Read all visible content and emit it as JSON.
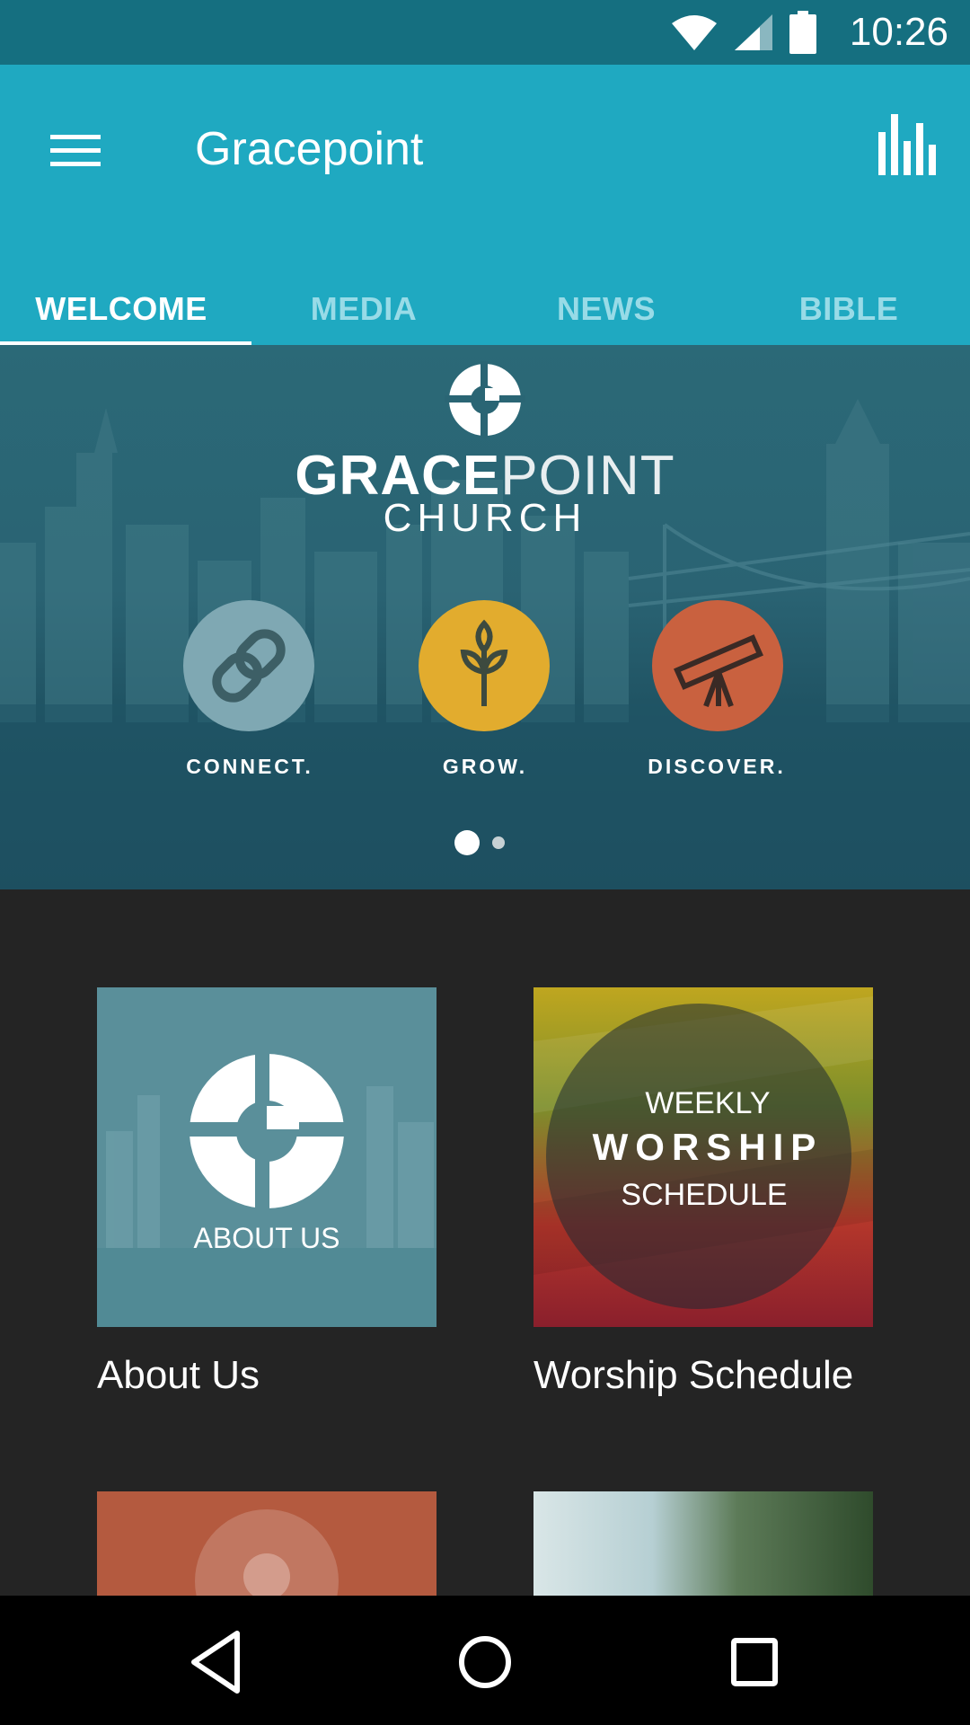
{
  "status_bar": {
    "time": "10:26",
    "icons": [
      "wifi-icon",
      "signal-icon",
      "battery-icon"
    ]
  },
  "app_bar": {
    "title": "Gracepoint",
    "menu_icon": "hamburger-menu-icon",
    "action_icon": "bar-chart-icon"
  },
  "tabs": [
    {
      "label": "WELCOME",
      "active": true
    },
    {
      "label": "MEDIA",
      "active": false
    },
    {
      "label": "NEWS",
      "active": false
    },
    {
      "label": "BIBLE",
      "active": false
    }
  ],
  "hero": {
    "brand_bold": "GRACE",
    "brand_light": "POINT",
    "brand_sub": "CHURCH",
    "pillars": [
      {
        "label": "CONNECT.",
        "icon": "chain-link-icon",
        "color": "#7fa8b3"
      },
      {
        "label": "GROW.",
        "icon": "sprout-icon",
        "color": "#e2ac2e"
      },
      {
        "label": "DISCOVER.",
        "icon": "telescope-icon",
        "color": "#c9613f"
      }
    ],
    "page_index": 1,
    "page_count": 2
  },
  "cards": [
    {
      "image_text": "ABOUT US",
      "caption": "About Us"
    },
    {
      "image_text_top": "WEEKLY",
      "image_text_mid": "WORSHIP",
      "image_text_bottom": "SCHEDULE",
      "caption": "Worship Schedule"
    }
  ],
  "nav_bar": {
    "icons": [
      "back-icon",
      "home-icon",
      "recents-icon"
    ]
  },
  "colors": {
    "status_bar": "#156f80",
    "app_bar": "#1fa9c1",
    "inactive_tab": "#98dbe7",
    "background": "#242424"
  }
}
